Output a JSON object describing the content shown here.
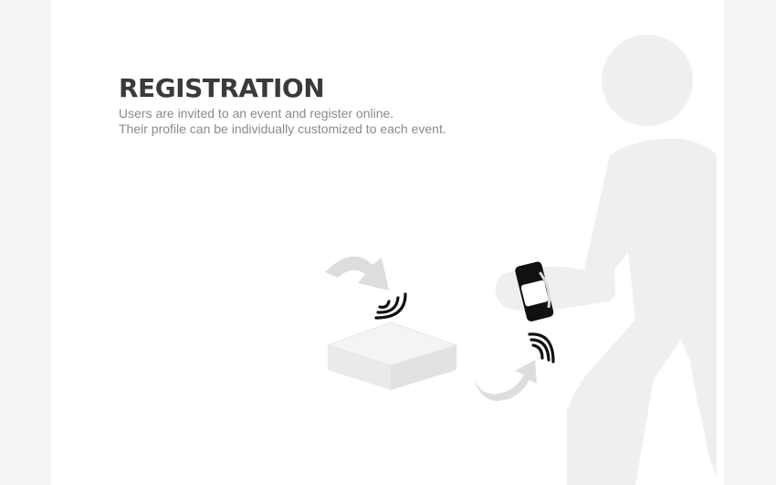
{
  "heading": {
    "title": "REGISTRATION",
    "lines": [
      "Users are invited to an event and register online.",
      "Their profile can be individually customized to each event."
    ]
  },
  "icons": [
    "person-icon",
    "wristband-icon",
    "nfc-reader-icon",
    "curved-arrow-icon",
    "wireless-signal-icon"
  ]
}
